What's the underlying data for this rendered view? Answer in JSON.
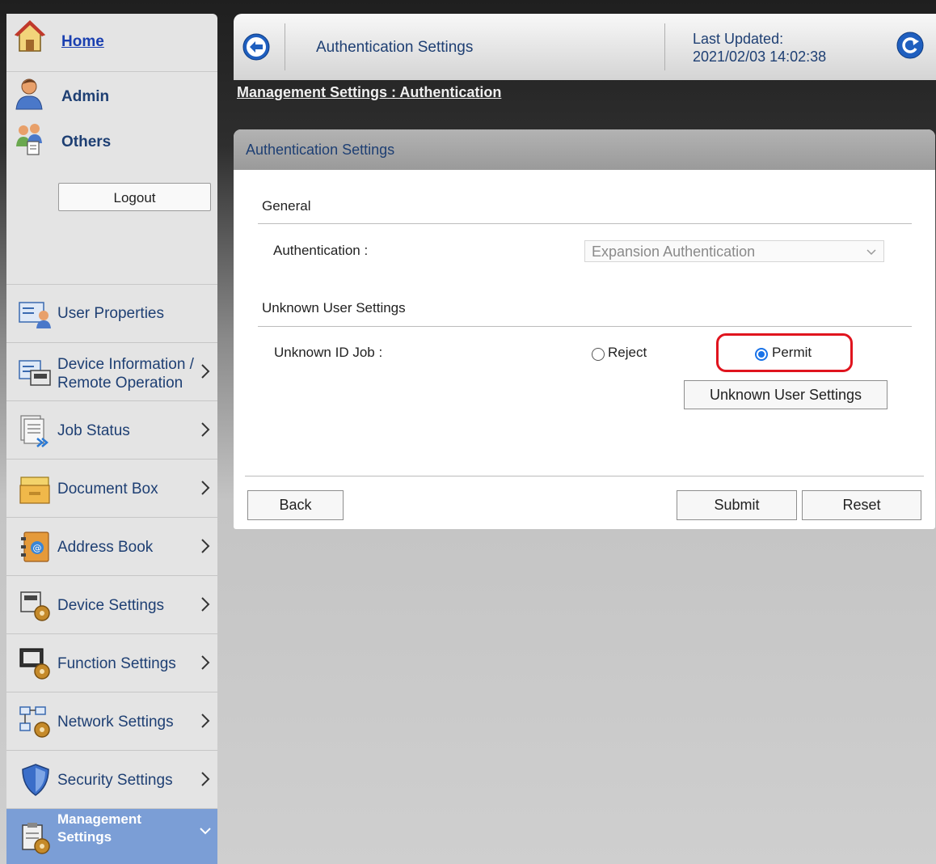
{
  "sidebar": {
    "home": {
      "label": "Home",
      "icon": "home-icon"
    },
    "admin": {
      "label": "Admin",
      "icon": "admin-user-icon"
    },
    "others": {
      "label": "Others",
      "icon": "others-users-icon"
    },
    "logout_label": "Logout",
    "nav": [
      {
        "line1": "User Properties",
        "line2": "",
        "icon": "user-properties-icon",
        "chevron": false
      },
      {
        "line1": "Device Information /",
        "line2": "Remote Operation",
        "icon": "device-information-icon",
        "chevron": true
      },
      {
        "line1": "Job Status",
        "line2": "",
        "icon": "job-status-icon",
        "chevron": true
      },
      {
        "line1": "Document Box",
        "line2": "",
        "icon": "document-box-icon",
        "chevron": true
      },
      {
        "line1": "Address Book",
        "line2": "",
        "icon": "address-book-icon",
        "chevron": true
      },
      {
        "line1": "Device Settings",
        "line2": "",
        "icon": "device-settings-icon",
        "chevron": true
      },
      {
        "line1": "Function Settings",
        "line2": "",
        "icon": "function-settings-icon",
        "chevron": true
      },
      {
        "line1": "Network Settings",
        "line2": "",
        "icon": "network-settings-icon",
        "chevron": true
      },
      {
        "line1": "Security Settings",
        "line2": "",
        "icon": "security-settings-icon",
        "chevron": true
      },
      {
        "line1": "Management",
        "line2": "Settings",
        "icon": "management-settings-icon",
        "chevron": true,
        "active": true
      }
    ]
  },
  "header": {
    "title": "Authentication Settings",
    "last_updated_label": "Last Updated:",
    "last_updated_value": "2021/02/03 14:02:38"
  },
  "breadcrumb": "Management Settings : Authentication",
  "panel": {
    "title": "Authentication Settings",
    "general_label": "General",
    "authentication_label": "Authentication :",
    "authentication_value": "Expansion Authentication",
    "unknown_user_section": "Unknown User Settings",
    "unknown_id_job_label": "Unknown ID Job :",
    "reject_label": "Reject",
    "permit_label": "Permit",
    "selected_option": "Permit",
    "unknown_user_button": "Unknown User Settings",
    "back_button": "Back",
    "submit_button": "Submit",
    "reset_button": "Reset"
  },
  "colors": {
    "accent_link": "#1a3fb0",
    "nav_text": "#1e3f73",
    "active_nav_bg": "#7b9ed6",
    "highlight": "#e0141e",
    "radio_selected": "#1a73e8"
  }
}
